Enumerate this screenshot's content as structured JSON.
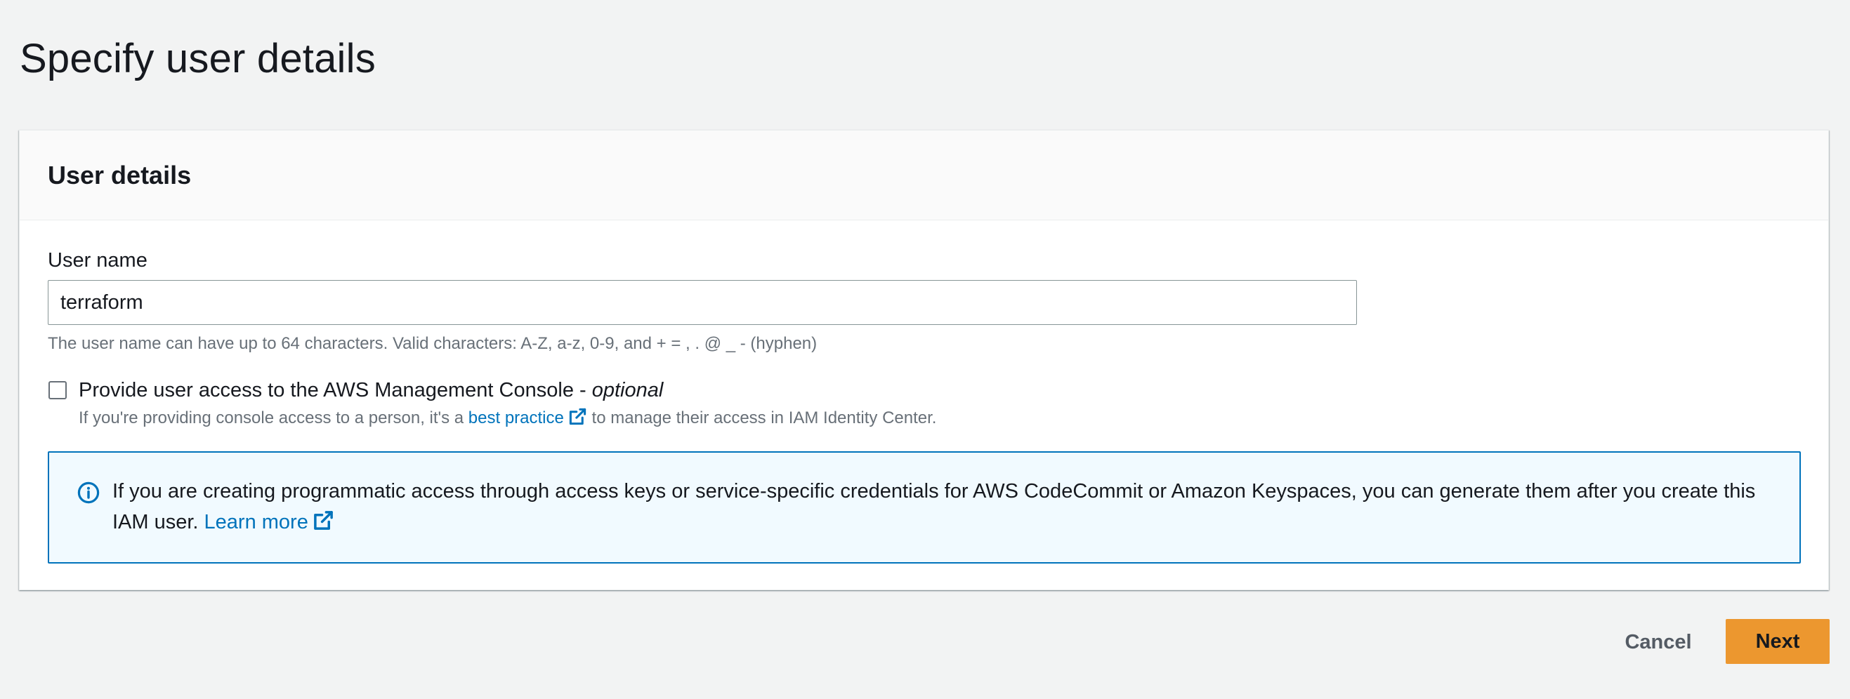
{
  "page": {
    "title": "Specify user details"
  },
  "panel": {
    "title": "User details"
  },
  "user_name": {
    "label": "User name",
    "value": "terraform",
    "hint": "The user name can have up to 64 characters. Valid characters: A-Z, a-z, 0-9, and + = , . @ _ - (hyphen)"
  },
  "console_access": {
    "label": "Provide user access to the AWS Management Console - ",
    "label_optional": "optional",
    "checked": false,
    "desc_before": "If you're providing console access to a person, it's a ",
    "desc_link": "best practice",
    "desc_after": " to manage their access in IAM Identity Center."
  },
  "info": {
    "text": "If you are creating programmatic access through access keys or service-specific credentials for AWS CodeCommit or Amazon Keyspaces, you can generate them after you create this IAM user. ",
    "link": "Learn more",
    "icon": "info-circle-icon"
  },
  "actions": {
    "cancel": "Cancel",
    "next": "Next"
  },
  "colors": {
    "link": "#0073bb",
    "primary": "#ec972f",
    "info_bg": "#f1faff",
    "page_bg": "#f2f3f3"
  }
}
